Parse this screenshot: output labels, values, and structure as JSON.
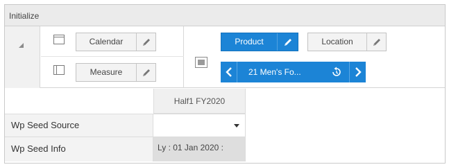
{
  "window": {
    "title": "Initialize"
  },
  "pivot": {
    "row_axis": {
      "dimension": "Calendar"
    },
    "column_axis": {
      "dimension": "Measure"
    },
    "page_axis": {
      "active_dimension": "Product",
      "other_dimension": "Location",
      "navigator": {
        "current_member": "21 Men's Fo..."
      }
    }
  },
  "grid": {
    "column_header": "Half1 FY2020",
    "rows": [
      {
        "label": "Wp Seed Source",
        "value": ""
      },
      {
        "label": "Wp Seed Info",
        "value": "Ly : 01 Jan 2020 :"
      }
    ]
  },
  "colors": {
    "accent": "#1c84d6",
    "title_bar": "#ebebeb",
    "readonly_cell": "#dedede"
  },
  "icons": [
    "collapse-triangle-icon",
    "row-axis-icon",
    "column-axis-icon",
    "page-axis-icon",
    "pencil-icon",
    "chevron-left-icon",
    "reset-icon",
    "chevron-right-icon",
    "dropdown-caret-icon"
  ]
}
